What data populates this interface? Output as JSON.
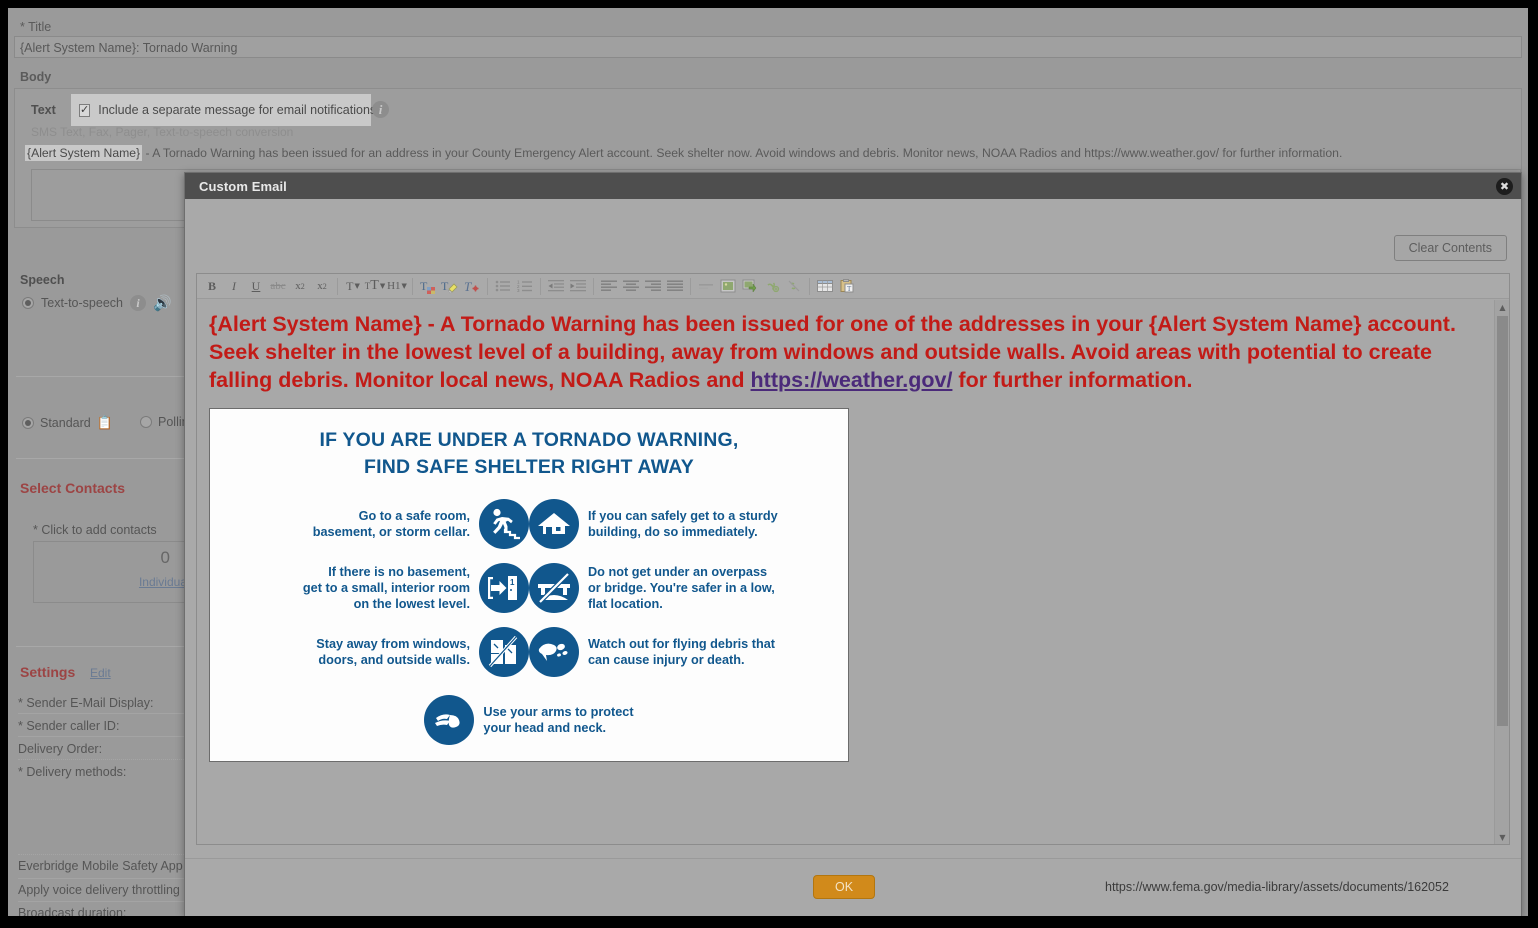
{
  "background_form": {
    "title_label": "* Title",
    "title_value": "{Alert System Name}: Tornado Warning",
    "body_label": "Body",
    "text_label": "Text",
    "email_checkbox_label": "Include a separate message for email notifications",
    "email_checkbox_checked": true,
    "sms_subtitle": "SMS Text, Fax, Pager, Text-to-speech conversion",
    "message_token": "{Alert System Name}",
    "message_rest": " - A Tornado Warning has been issued for an address in your County Emergency Alert account. Seek shelter now. Avoid windows and debris. Monitor news, NOAA Radios and https://www.weather.gov/ for further information.",
    "speech_label": "Speech",
    "tts_label": "Text-to-speech",
    "standard_label": "Standard",
    "polling_label": "Polling",
    "select_contacts_header": "Select Contacts",
    "click_to_add_contacts": "* Click to add contacts",
    "contacts_count": "0",
    "contacts_link": "Individua",
    "settings_header": "Settings",
    "settings_edit": "Edit",
    "settings_rows": [
      "* Sender E-Mail Display:",
      "* Sender caller ID:",
      "Delivery Order:",
      "*  Delivery methods:"
    ],
    "mobile_app_row": "Everbridge Mobile Safety App",
    "throttle_row": "Apply voice delivery throttling",
    "duration_row": "Broadcast duration:"
  },
  "dialog": {
    "title": "Custom Email",
    "close_icon": "close-icon",
    "clear_contents_label": "Clear Contents",
    "ok_label": "OK",
    "status_url": "https://www.fema.gov/media-library/assets/documents/162052"
  },
  "toolbar": {
    "groups": [
      [
        {
          "name": "bold-button",
          "glyph": "B",
          "style": "bold"
        },
        {
          "name": "italic-button",
          "glyph": "I",
          "style": "italic"
        },
        {
          "name": "underline-button",
          "glyph": "U",
          "style": "underline"
        },
        {
          "name": "strikethrough-button",
          "glyph": "abc",
          "style": "strike"
        },
        {
          "name": "subscript-button",
          "glyph": "x₂",
          "style": "plain"
        },
        {
          "name": "superscript-button",
          "glyph": "x²",
          "style": "plain"
        }
      ],
      [
        {
          "name": "font-size-dropdown",
          "glyph": "T",
          "style": "dropdown"
        },
        {
          "name": "font-family-dropdown",
          "glyph": "TT",
          "style": "dropdown"
        },
        {
          "name": "heading-dropdown",
          "glyph": "H1",
          "style": "dropdown"
        }
      ],
      [
        {
          "name": "text-color-button",
          "glyph": "T",
          "style": "color-fg"
        },
        {
          "name": "highlight-color-button",
          "glyph": "T",
          "style": "color-hl"
        },
        {
          "name": "remove-format-button",
          "glyph": "T",
          "style": "color-clear"
        }
      ],
      [
        {
          "name": "bullet-list-button",
          "glyph": "list-bullets-icon",
          "style": "icon"
        },
        {
          "name": "numbered-list-button",
          "glyph": "list-numbers-icon",
          "style": "icon"
        }
      ],
      [
        {
          "name": "decrease-indent-button",
          "glyph": "outdent-icon",
          "style": "icon"
        },
        {
          "name": "increase-indent-button",
          "glyph": "indent-icon",
          "style": "icon"
        }
      ],
      [
        {
          "name": "align-left-button",
          "glyph": "align-left-icon",
          "style": "icon"
        },
        {
          "name": "align-center-button",
          "glyph": "align-center-icon",
          "style": "icon"
        },
        {
          "name": "align-right-button",
          "glyph": "align-right-icon",
          "style": "icon"
        },
        {
          "name": "align-justify-button",
          "glyph": "align-justify-icon",
          "style": "icon"
        }
      ],
      [
        {
          "name": "horizontal-rule-button",
          "glyph": "hr-icon",
          "style": "icon"
        },
        {
          "name": "insert-image-button",
          "glyph": "image-icon",
          "style": "icon"
        },
        {
          "name": "insert-media-button",
          "glyph": "media-icon",
          "style": "icon"
        },
        {
          "name": "insert-link-button",
          "glyph": "link-icon",
          "style": "icon"
        },
        {
          "name": "unlink-button",
          "glyph": "unlink-icon",
          "style": "icon"
        }
      ],
      [
        {
          "name": "insert-table-button",
          "glyph": "table-icon",
          "style": "icon"
        },
        {
          "name": "paste-as-text-button",
          "glyph": "paste-text-icon",
          "style": "icon"
        }
      ]
    ]
  },
  "editor": {
    "paragraph_pre_link": "{Alert System Name} - A Tornado Warning has been issued for one of the addresses in your {Alert System Name} account. Seek shelter in the lowest level of a building, away from windows and outside walls. Avoid areas with potential to create falling debris. Monitor local news, NOAA Radios and ",
    "paragraph_link": "https://weather.gov/",
    "paragraph_post_link": " for further information.",
    "text_color": "#c21b17",
    "link_color": "#4b2a7a"
  },
  "infographic": {
    "brand_color": "#11578d",
    "title_line1": "IF YOU ARE UNDER A TORNADO WARNING,",
    "title_line2": "FIND SAFE SHELTER RIGHT AWAY",
    "left_items": [
      {
        "icon": "running-person-stairs-icon",
        "text": "Go to a safe room,\nbasement, or storm cellar."
      },
      {
        "icon": "interior-room-door-arrow-icon",
        "text": "If there is no basement,\nget to a small, interior room\non the lowest level."
      },
      {
        "icon": "no-windows-doors-icon",
        "text": "Stay away from windows,\ndoors, and outside walls."
      }
    ],
    "right_items": [
      {
        "icon": "sturdy-building-house-icon",
        "text": "If you can safely get to a sturdy\nbuilding, do so immediately."
      },
      {
        "icon": "no-overpass-bridge-icon",
        "text": "Do not get under an overpass\nor bridge. You're safer in a low,\nflat location."
      },
      {
        "icon": "flying-debris-icon",
        "text": "Watch out for flying debris that\ncan cause injury or death."
      }
    ],
    "last_item": {
      "icon": "cover-head-arms-icon",
      "text": "Use your arms to protect\nyour head and neck."
    }
  }
}
